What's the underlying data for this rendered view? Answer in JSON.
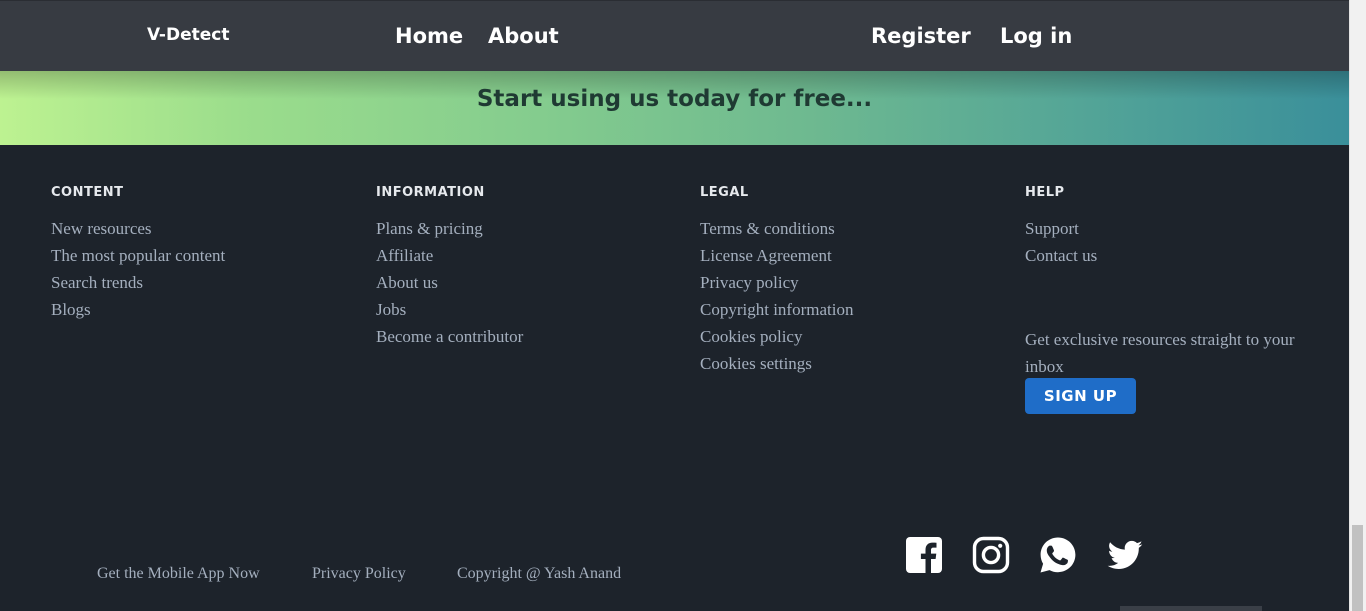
{
  "nav": {
    "brand": "V-Detect",
    "home": "Home",
    "about": "About",
    "register": "Register",
    "login": "Log in"
  },
  "banner": {
    "text": "Start using us today for free..."
  },
  "footer": {
    "columns": [
      {
        "heading": "CONTENT",
        "links": [
          "New resources",
          "The most popular content",
          "Search trends",
          "Blogs"
        ]
      },
      {
        "heading": "INFORMATION",
        "links": [
          "Plans & pricing",
          "Affiliate",
          "About us",
          "Jobs",
          "Become a contributor"
        ]
      },
      {
        "heading": "LEGAL",
        "links": [
          "Terms & conditions",
          "License Agreement",
          "Privacy policy",
          "Copyright information",
          "Cookies policy",
          "Cookies settings"
        ]
      },
      {
        "heading": "HELP",
        "links": [
          "Support",
          "Contact us"
        ]
      }
    ],
    "newsletter_text": "Get exclusive resources straight to your inbox",
    "signup_label": "SIGN UP",
    "bottom": {
      "app": "Get the Mobile App Now",
      "privacy": "Privacy Policy",
      "copyright": "Copyright @ Yash Anand"
    },
    "social_icons": [
      "facebook-icon",
      "instagram-icon",
      "whatsapp-icon",
      "twitter-icon"
    ]
  },
  "colors": {
    "navbar": "#373b42",
    "footer": "#1d232b",
    "banner_start": "#bdf291",
    "banner_end": "#3a8f9a",
    "signup_button": "#1f6dc8",
    "link_text": "#a4afbe"
  }
}
